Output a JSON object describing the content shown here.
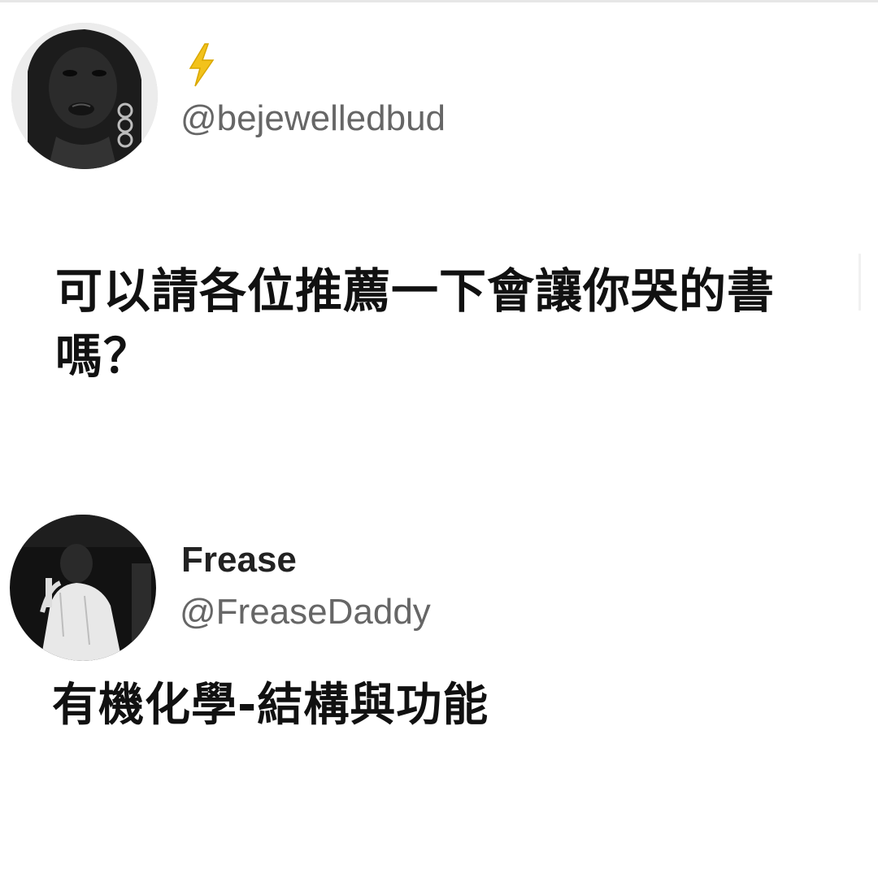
{
  "posts": [
    {
      "display_name": "",
      "emoji": "lightning-bolt",
      "handle": "@bejewelledbud",
      "text": "可以請各位推薦一下會讓你哭的書嗎？"
    },
    {
      "display_name": "Frease",
      "handle": "@FreaseDaddy",
      "text": "有機化學-結構與功能"
    }
  ],
  "colors": {
    "background": "#ffffff",
    "text": "#111111",
    "handle": "#666666",
    "bolt": "#f2c21b"
  }
}
